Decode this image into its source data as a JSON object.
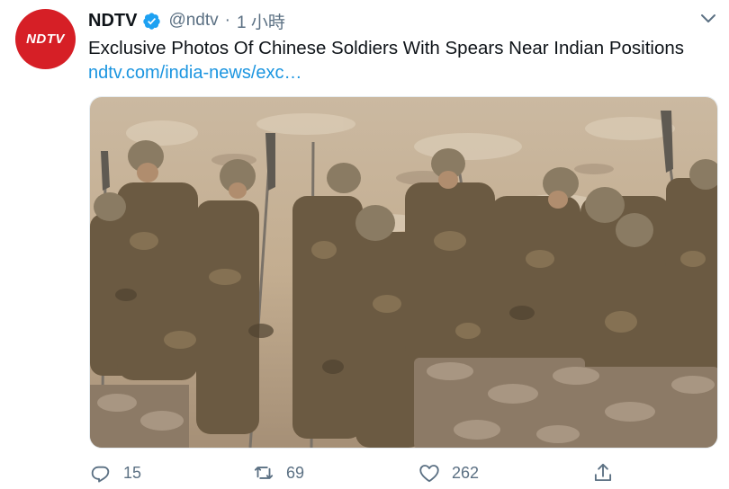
{
  "author": {
    "name": "NDTV",
    "handle": "@ndtv",
    "separator": "·",
    "time": "1 小時",
    "avatar_text": "NDTV",
    "verified": true,
    "avatar_color": "#d61f26",
    "verified_color": "#1da1f2"
  },
  "tweet": {
    "text": "Exclusive Photos Of Chinese Soldiers With Spears Near Indian Positions",
    "link": "ndtv.com/india-news/exc…",
    "link_color": "#1b95e0"
  },
  "actions": {
    "reply": {
      "icon": "reply-icon",
      "count": "15"
    },
    "retweet": {
      "icon": "retweet-icon",
      "count": "69"
    },
    "like": {
      "icon": "heart-icon",
      "count": "262"
    },
    "share": {
      "icon": "share-icon"
    }
  },
  "menu": {
    "icon": "chevron-down-icon"
  }
}
